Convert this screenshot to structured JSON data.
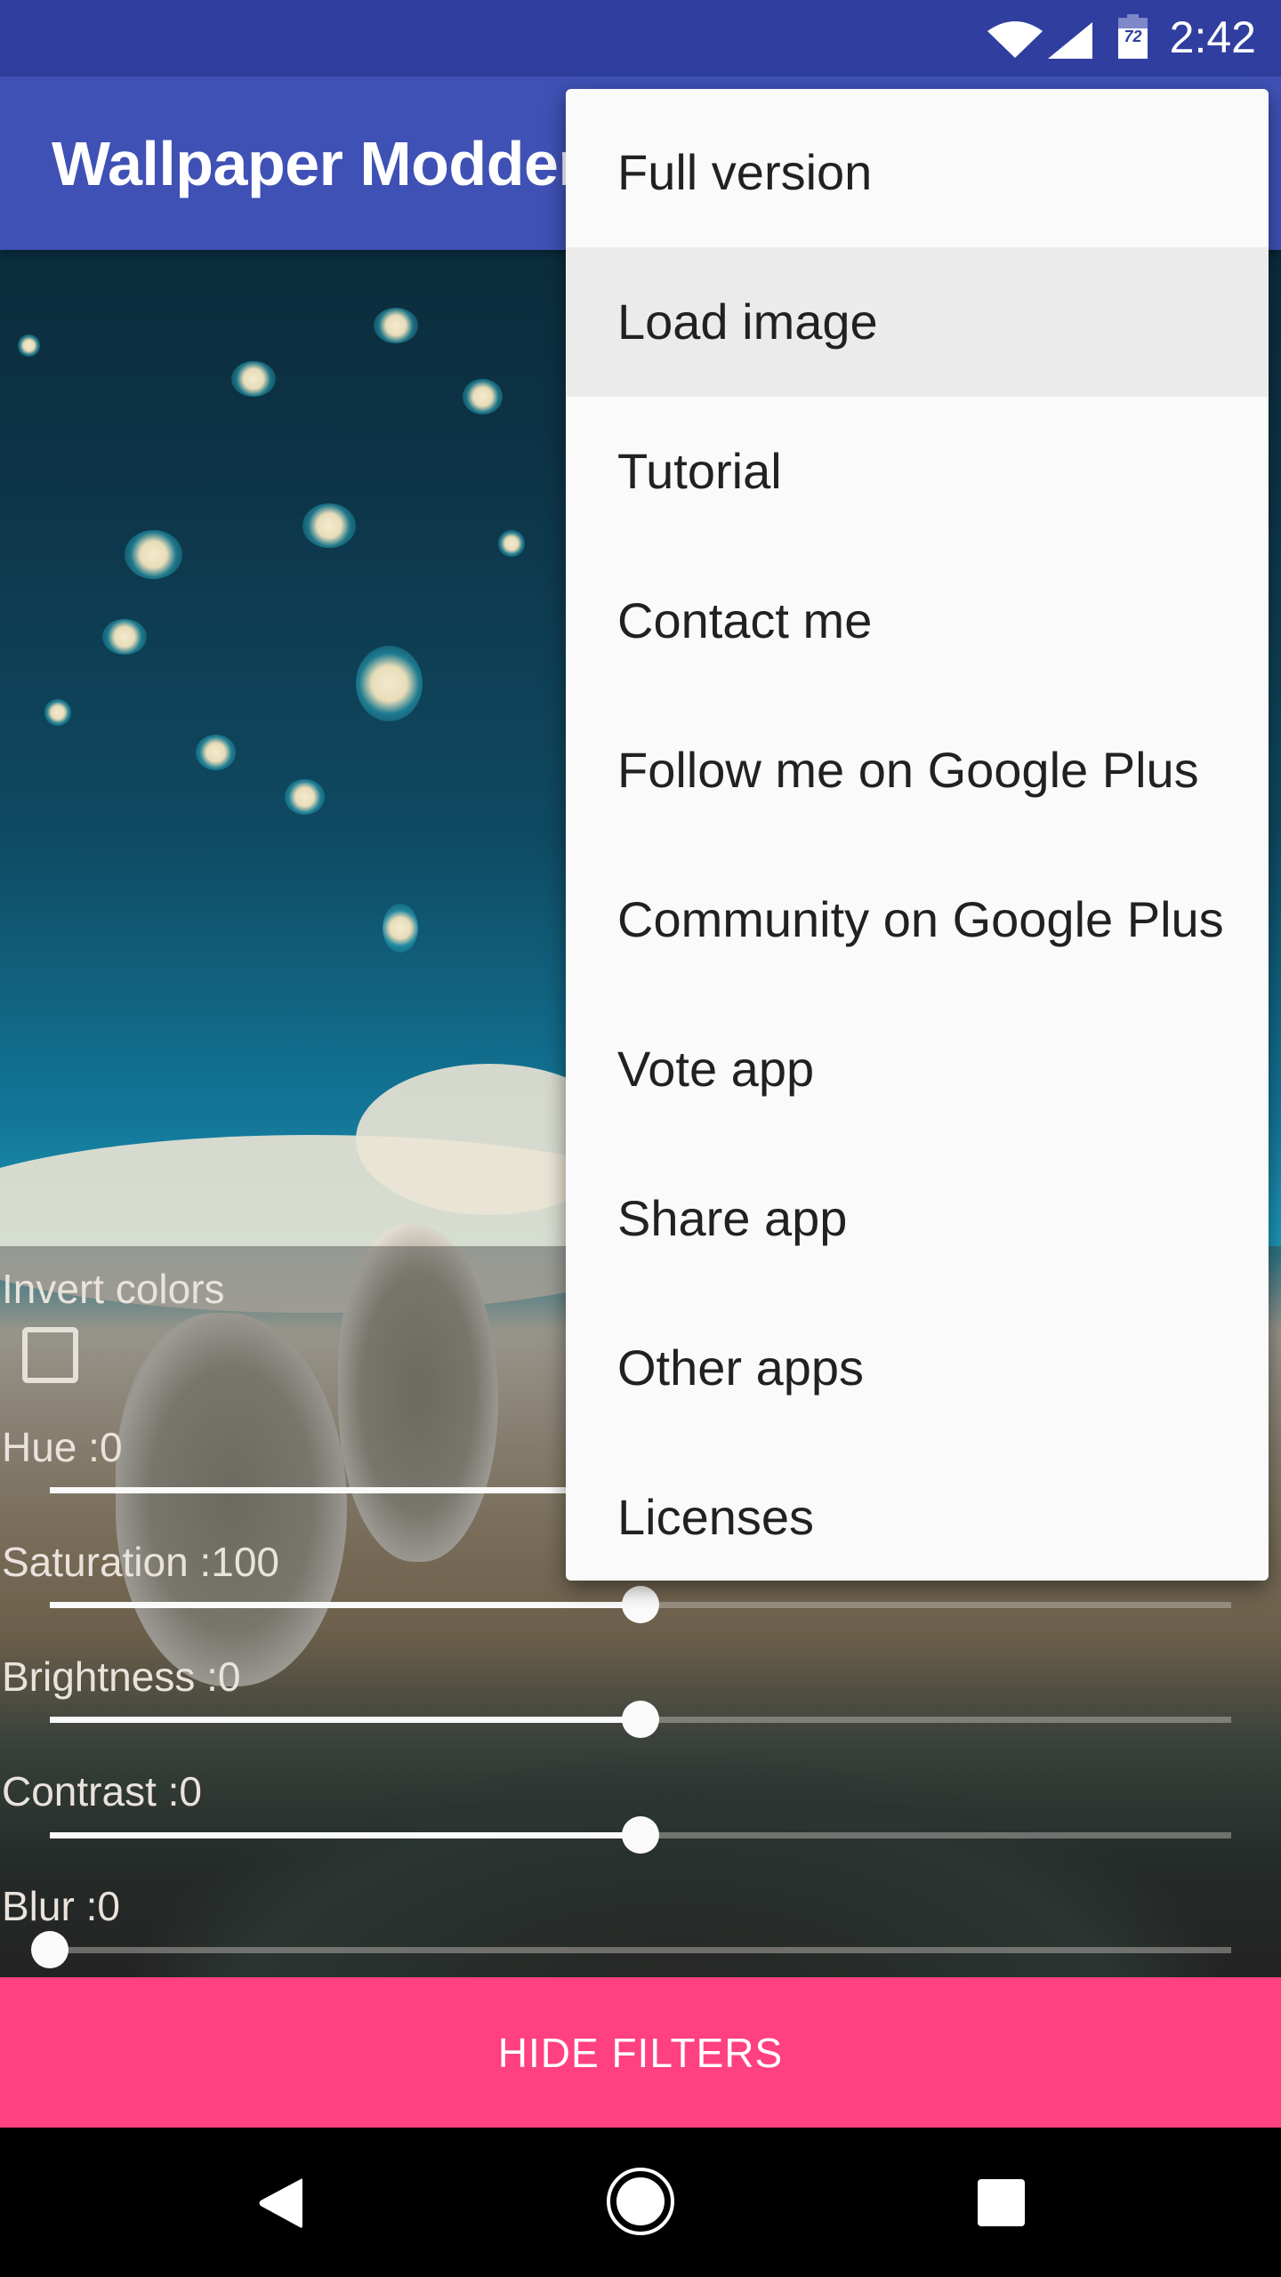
{
  "status_bar": {
    "time": "2:42",
    "battery_level": "72",
    "icons": [
      "wifi-icon",
      "cell-signal-icon",
      "battery-icon"
    ],
    "color": "#303F9F"
  },
  "toolbar": {
    "title": "Wallpaper Modder",
    "color": "#3F51B5"
  },
  "overflow_menu": {
    "items": [
      {
        "label": "Full version",
        "highlighted": false
      },
      {
        "label": "Load image",
        "highlighted": true
      },
      {
        "label": "Tutorial",
        "highlighted": false
      },
      {
        "label": "Contact me",
        "highlighted": false
      },
      {
        "label": "Follow me on Google Plus",
        "highlighted": false
      },
      {
        "label": "Community on Google Plus",
        "highlighted": false
      },
      {
        "label": "Vote app",
        "highlighted": false
      },
      {
        "label": "Share app",
        "highlighted": false
      },
      {
        "label": "Other apps",
        "highlighted": false
      },
      {
        "label": "Licenses",
        "highlighted": false
      }
    ]
  },
  "filters": {
    "invert": {
      "label": "Invert colors",
      "checked": false
    },
    "sliders": [
      {
        "name": "hue",
        "label": "Hue :0",
        "value": 0,
        "fraction": 0.5
      },
      {
        "name": "saturation",
        "label": "Saturation :100",
        "value": 100,
        "fraction": 0.5
      },
      {
        "name": "brightness",
        "label": "Brightness :0",
        "value": 0,
        "fraction": 0.5
      },
      {
        "name": "contrast",
        "label": "Contrast :0",
        "value": 0,
        "fraction": 0.5
      },
      {
        "name": "blur",
        "label": "Blur :0",
        "value": 0,
        "fraction": 0.0
      }
    ]
  },
  "hide_filters_button": {
    "label": "HIDE FILTERS",
    "color": "#FF4081"
  },
  "nav_bar": {
    "buttons": [
      "back-icon",
      "home-icon",
      "recents-icon"
    ]
  }
}
